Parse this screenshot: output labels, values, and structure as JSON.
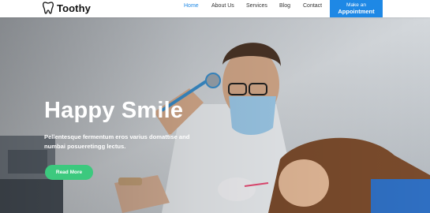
{
  "brand": {
    "name": "Toothy",
    "logo_icon": "tooth-icon"
  },
  "nav": {
    "items": [
      {
        "label": "Home",
        "active": true
      },
      {
        "label": "About Us",
        "active": false
      },
      {
        "label": "Services",
        "active": false
      },
      {
        "label": "Blog",
        "active": false
      },
      {
        "label": "Contact",
        "active": false
      }
    ],
    "cta_line1": "Make an",
    "cta_line2": "Appointment"
  },
  "hero": {
    "title": "Happy Smile",
    "text": "Pellentesque fermentum eros varius domattise and numbai posueretingg lectus.",
    "button_label": "Read More"
  },
  "colors": {
    "accent": "#1e88e5",
    "button": "#3cc97e"
  }
}
